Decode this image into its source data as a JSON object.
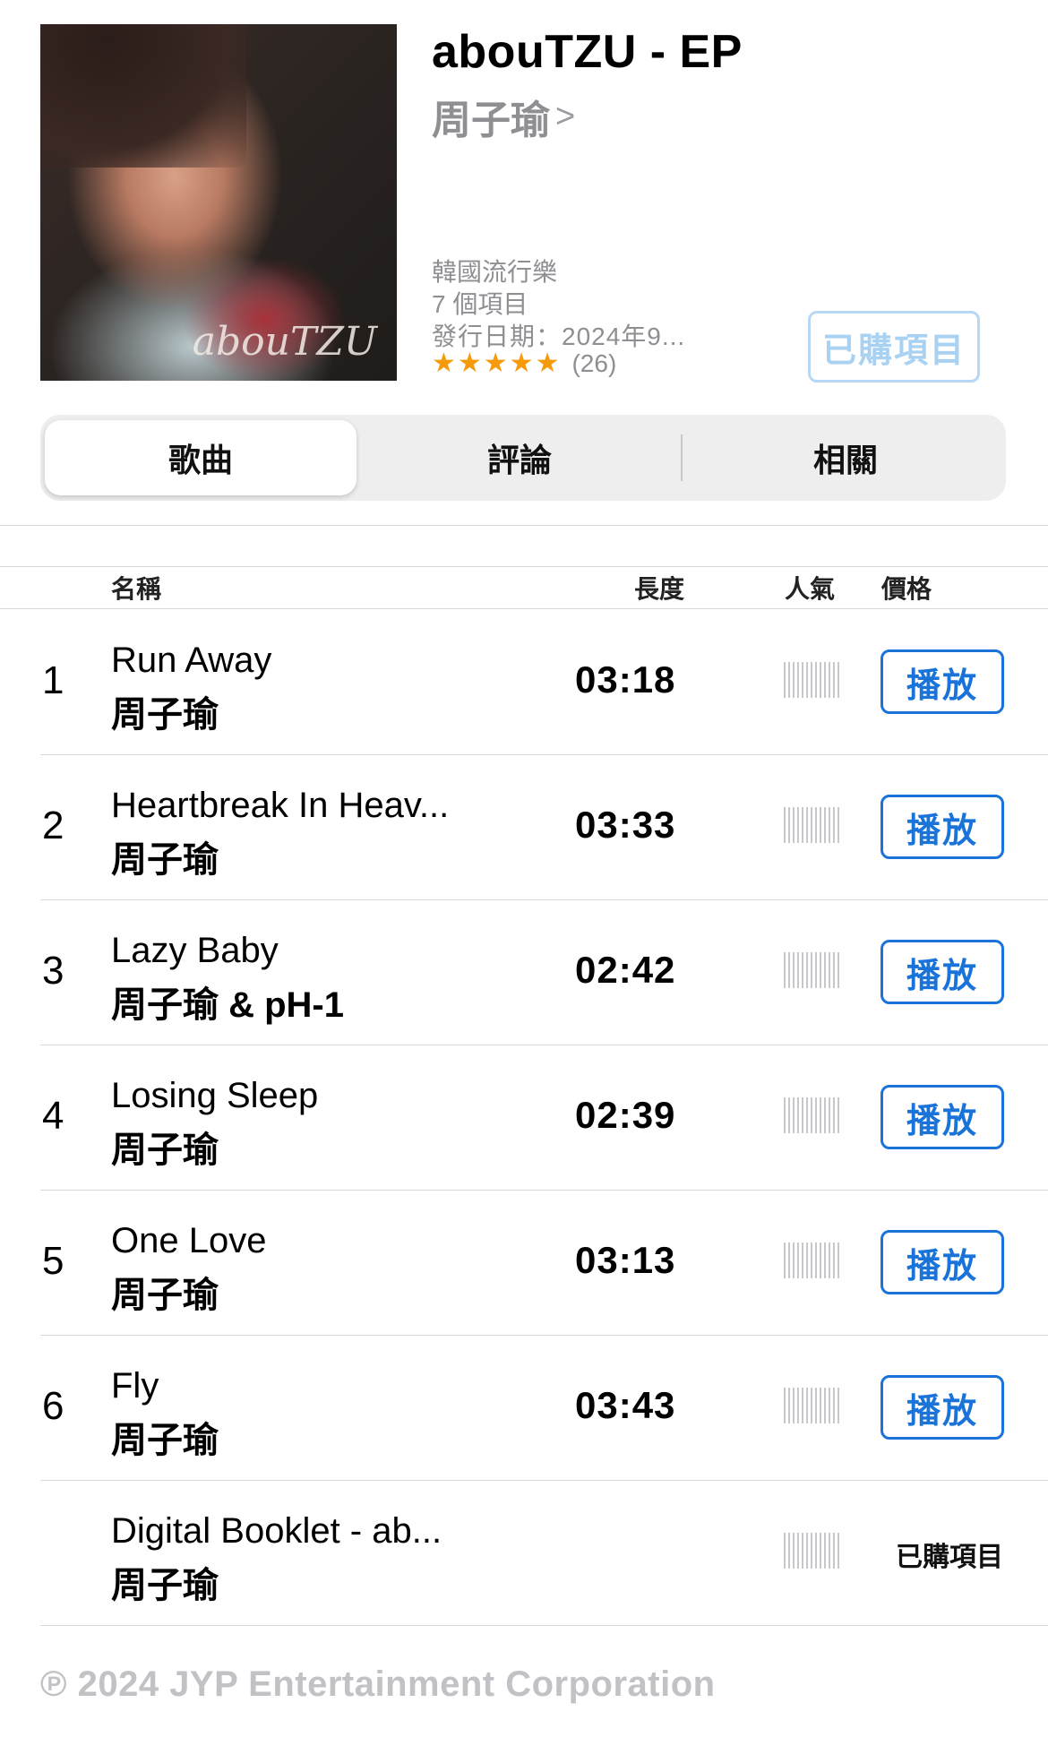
{
  "album": {
    "title": "abouTZU - EP",
    "artist": "周子瑜",
    "genre": "韓國流行樂",
    "item_count": "7 個項目",
    "release": "發行日期：2024年9...",
    "stars": "★★★★★",
    "rating_count": "(26)",
    "rating_value": 5,
    "purchased_label": "已購項目",
    "cover_signature": "abouTZU"
  },
  "tabs": [
    {
      "label": "歌曲",
      "active": true
    },
    {
      "label": "評論",
      "active": false
    },
    {
      "label": "相關",
      "active": false
    }
  ],
  "columns": {
    "name": "名稱",
    "length": "長度",
    "popularity": "人氣",
    "price": "價格"
  },
  "tracks": [
    {
      "num": "1",
      "title": "Run Away",
      "artist": "周子瑜",
      "duration": "03:18",
      "action": "播放"
    },
    {
      "num": "2",
      "title": "Heartbreak In Heav...",
      "artist": "周子瑜",
      "duration": "03:33",
      "action": "播放"
    },
    {
      "num": "3",
      "title": "Lazy Baby",
      "artist": "周子瑜 & pH-1",
      "duration": "02:42",
      "action": "播放"
    },
    {
      "num": "4",
      "title": "Losing Sleep",
      "artist": "周子瑜",
      "duration": "02:39",
      "action": "播放"
    },
    {
      "num": "5",
      "title": "One Love",
      "artist": "周子瑜",
      "duration": "03:13",
      "action": "播放"
    },
    {
      "num": "6",
      "title": "Fly",
      "artist": "周子瑜",
      "duration": "03:43",
      "action": "播放"
    },
    {
      "num": "",
      "title": "Digital Booklet - ab...",
      "artist": "周子瑜",
      "duration": "",
      "action": "已購項目"
    }
  ],
  "copyright": "℗ 2024 JYP Entertainment Corporation",
  "colors": {
    "accent": "#1a73d9",
    "stars": "#f59b0b",
    "secondary_text": "#8e8e93"
  }
}
